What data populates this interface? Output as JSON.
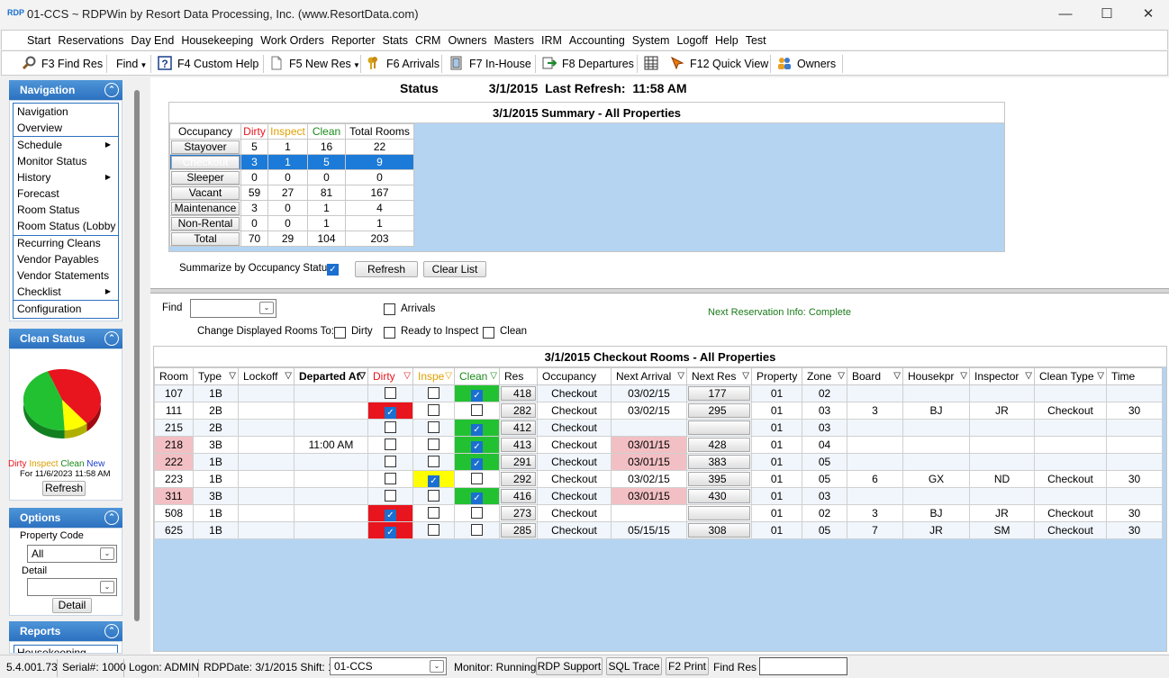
{
  "window": {
    "logo": "RDP",
    "title": "01-CCS ~ RDPWin by Resort Data Processing, Inc. (www.ResortData.com)"
  },
  "menu": [
    "Start",
    "Reservations",
    "Day End",
    "Housekeeping",
    "Work Orders",
    "Reporter",
    "Stats",
    "CRM",
    "Owners",
    "Masters",
    "IRM",
    "Accounting",
    "System",
    "Logoff",
    "Help",
    "Test"
  ],
  "toolbar": {
    "find_res": "F3 Find Res",
    "find": "Find",
    "custom_help": "F4 Custom Help",
    "new_res": "F5 New Res",
    "arrivals": "F6 Arrivals",
    "in_house": "F7 In-House",
    "departures": "F8 Departures",
    "quick_view": "F12 Quick View",
    "owners": "Owners"
  },
  "navigation": {
    "header": "Navigation",
    "items": [
      "Navigation",
      "Overview",
      "Schedule",
      "Monitor Status",
      "History",
      "Forecast",
      "Room Status",
      "Room Status (Lobby",
      "Recurring Cleans",
      "Vendor Payables",
      "Vendor Statements",
      "Checklist",
      "Configuration"
    ]
  },
  "clean_status": {
    "header": "Clean Status",
    "legend": {
      "dirty": "Dirty",
      "inspect": "Inspect",
      "clean": "Clean",
      "new": "New"
    },
    "timestamp": "For 11/6/2023 11:58 AM",
    "refresh": "Refresh",
    "pie": {
      "dirty": 45,
      "inspect": 10,
      "clean": 45
    }
  },
  "options": {
    "header": "Options",
    "property_code_label": "Property Code",
    "property_code_value": "All",
    "detail_label": "Detail",
    "detail_value": "",
    "detail_button": "Detail"
  },
  "reports": {
    "header": "Reports",
    "first_item": "Housekeeping"
  },
  "status": {
    "label": "Status",
    "date": "3/1/2015",
    "refresh_text": "Last Refresh:",
    "refresh_time": "11:58 AM"
  },
  "summary": {
    "title": "3/1/2015 Summary - All Properties",
    "headers": [
      "Occupancy",
      "Dirty",
      "Inspect",
      "Clean",
      "Total Rooms"
    ],
    "rows": [
      {
        "label": "Stayover",
        "dirty": "5",
        "inspect": "1",
        "clean": "16",
        "total": "22"
      },
      {
        "label": "Checkout",
        "dirty": "3",
        "inspect": "1",
        "clean": "5",
        "total": "9"
      },
      {
        "label": "Sleeper",
        "dirty": "0",
        "inspect": "0",
        "clean": "0",
        "total": "0"
      },
      {
        "label": "Vacant",
        "dirty": "59",
        "inspect": "27",
        "clean": "81",
        "total": "167"
      },
      {
        "label": "Maintenance",
        "dirty": "3",
        "inspect": "0",
        "clean": "1",
        "total": "4"
      },
      {
        "label": "Non-Rental",
        "dirty": "0",
        "inspect": "0",
        "clean": "1",
        "total": "1"
      },
      {
        "label": "Total",
        "dirty": "70",
        "inspect": "29",
        "clean": "104",
        "total": "203"
      }
    ],
    "selected_row": 1,
    "summarize_label": "Summarize by Occupancy Status",
    "refresh": "Refresh",
    "clear_list": "Clear List"
  },
  "filters": {
    "find_label": "Find",
    "arrivals": "Arrivals",
    "change_label": "Change Displayed Rooms To:",
    "dirty": "Dirty",
    "ready": "Ready to Inspect",
    "clean": "Clean",
    "next_res_info": "Next Reservation Info: Complete"
  },
  "checkout": {
    "title": "3/1/2015 Checkout Rooms - All Properties",
    "headers": [
      "Room",
      "Type",
      "Lockoff",
      "Departed At",
      "Dirty",
      "Inspe",
      "Clean",
      "Res",
      "Occupancy",
      "Next Arrival",
      "Next Res",
      "Property",
      "Zone",
      "Board",
      "Housekpr",
      "Inspector",
      "Clean Type",
      "Time"
    ],
    "rows": [
      {
        "room": "107",
        "type": "1B",
        "lockoff": "",
        "departed": "",
        "dirty": false,
        "inspect": false,
        "clean": true,
        "res": "418",
        "occ": "Checkout",
        "next_arrival": "03/02/15",
        "next_res": "177",
        "property": "01",
        "zone": "02",
        "board": "",
        "housekpr": "",
        "inspector": "",
        "clean_type": "",
        "time": "",
        "room_pink": false,
        "arr_pink": false
      },
      {
        "room": "111",
        "type": "2B",
        "lockoff": "",
        "departed": "",
        "dirty": true,
        "inspect": false,
        "clean": false,
        "res": "282",
        "occ": "Checkout",
        "next_arrival": "03/02/15",
        "next_res": "295",
        "property": "01",
        "zone": "03",
        "board": "3",
        "housekpr": "BJ",
        "inspector": "JR",
        "clean_type": "Checkout",
        "time": "30",
        "room_pink": false,
        "arr_pink": false
      },
      {
        "room": "215",
        "type": "2B",
        "lockoff": "",
        "departed": "",
        "dirty": false,
        "inspect": false,
        "clean": true,
        "res": "412",
        "occ": "Checkout",
        "next_arrival": "",
        "next_res": "",
        "property": "01",
        "zone": "03",
        "board": "",
        "housekpr": "",
        "inspector": "",
        "clean_type": "",
        "time": "",
        "room_pink": false,
        "arr_pink": false
      },
      {
        "room": "218",
        "type": "3B",
        "lockoff": "",
        "departed": "11:00 AM",
        "dirty": false,
        "inspect": false,
        "clean": true,
        "res": "413",
        "occ": "Checkout",
        "next_arrival": "03/01/15",
        "next_res": "428",
        "property": "01",
        "zone": "04",
        "board": "",
        "housekpr": "",
        "inspector": "",
        "clean_type": "",
        "time": "",
        "room_pink": true,
        "arr_pink": true
      },
      {
        "room": "222",
        "type": "1B",
        "lockoff": "",
        "departed": "",
        "dirty": false,
        "inspect": false,
        "clean": true,
        "res": "291",
        "occ": "Checkout",
        "next_arrival": "03/01/15",
        "next_res": "383",
        "property": "01",
        "zone": "05",
        "board": "",
        "housekpr": "",
        "inspector": "",
        "clean_type": "",
        "time": "",
        "room_pink": true,
        "arr_pink": true
      },
      {
        "room": "223",
        "type": "1B",
        "lockoff": "",
        "departed": "",
        "dirty": false,
        "inspect": true,
        "clean": false,
        "res": "292",
        "occ": "Checkout",
        "next_arrival": "03/02/15",
        "next_res": "395",
        "property": "01",
        "zone": "05",
        "board": "6",
        "housekpr": "GX",
        "inspector": "ND",
        "clean_type": "Checkout",
        "time": "30",
        "room_pink": false,
        "arr_pink": false
      },
      {
        "room": "311",
        "type": "3B",
        "lockoff": "",
        "departed": "",
        "dirty": false,
        "inspect": false,
        "clean": true,
        "res": "416",
        "occ": "Checkout",
        "next_arrival": "03/01/15",
        "next_res": "430",
        "property": "01",
        "zone": "03",
        "board": "",
        "housekpr": "",
        "inspector": "",
        "clean_type": "",
        "time": "",
        "room_pink": true,
        "arr_pink": true
      },
      {
        "room": "508",
        "type": "1B",
        "lockoff": "",
        "departed": "",
        "dirty": true,
        "inspect": false,
        "clean": false,
        "res": "273",
        "occ": "Checkout",
        "next_arrival": "",
        "next_res": "",
        "property": "01",
        "zone": "02",
        "board": "3",
        "housekpr": "BJ",
        "inspector": "JR",
        "clean_type": "Checkout",
        "time": "30",
        "room_pink": false,
        "arr_pink": false
      },
      {
        "room": "625",
        "type": "1B",
        "lockoff": "",
        "departed": "",
        "dirty": true,
        "inspect": false,
        "clean": false,
        "res": "285",
        "occ": "Checkout",
        "next_arrival": "05/15/15",
        "next_res": "308",
        "property": "01",
        "zone": "05",
        "board": "7",
        "housekpr": "JR",
        "inspector": "SM",
        "clean_type": "Checkout",
        "time": "30",
        "room_pink": false,
        "arr_pink": false
      }
    ]
  },
  "statusbar": {
    "version": "5.4.001.73",
    "serial": "Serial#: 1000",
    "logon": "Logon: ADMIN",
    "rdpdate": "RDPDate: 3/1/2015 Shift: 1",
    "property": "01-CCS",
    "monitor": "Monitor: Running",
    "support": "RDP Support",
    "sql": "SQL Trace",
    "print": "F2 Print",
    "find_res": "Find Res"
  },
  "colors": {
    "accent": "#2b71c0",
    "dirty": "#e8141e",
    "inspect": "#ffff00",
    "clean": "#22c132",
    "pink": "#f2c0c4",
    "grid_bg": "#b4d4f2"
  }
}
